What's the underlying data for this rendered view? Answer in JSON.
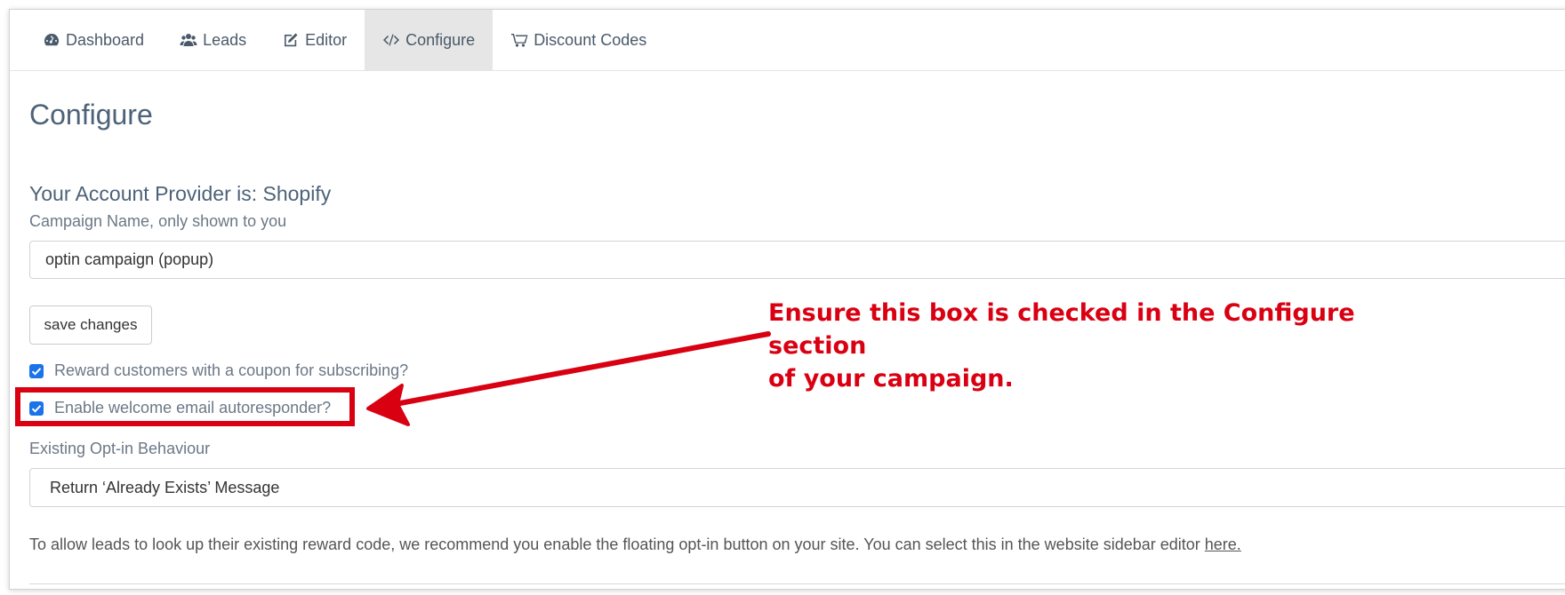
{
  "tabs": [
    {
      "label": "Dashboard",
      "icon": "dashboard-icon",
      "active": false
    },
    {
      "label": "Leads",
      "icon": "users-icon",
      "active": false
    },
    {
      "label": "Editor",
      "icon": "edit-icon",
      "active": false
    },
    {
      "label": "Configure",
      "icon": "code-icon",
      "active": true
    },
    {
      "label": "Discount Codes",
      "icon": "cart-icon",
      "active": false
    }
  ],
  "page": {
    "title": "Configure",
    "provider": "Your Account Provider is: Shopify"
  },
  "campaign": {
    "label": "Campaign Name, only shown to you",
    "value": "optin campaign (popup)",
    "save_label": "save changes"
  },
  "options": {
    "reward_label": "Reward customers with a coupon for subscribing?",
    "reward_checked": true,
    "welcome_label": "Enable welcome email autoresponder?",
    "welcome_checked": true
  },
  "optin": {
    "label": "Existing Opt-in Behaviour",
    "selected": "Return ‘Already Exists’ Message"
  },
  "note": {
    "text": "To allow leads to look up their existing reward code, we recommend you enable the floating opt-in button on your site. You can select this in the website sidebar editor ",
    "link": "here."
  },
  "annotation": {
    "line1": "Ensure this box is checked in the Configure section",
    "line2": "of your campaign.",
    "color": "#d90012"
  }
}
